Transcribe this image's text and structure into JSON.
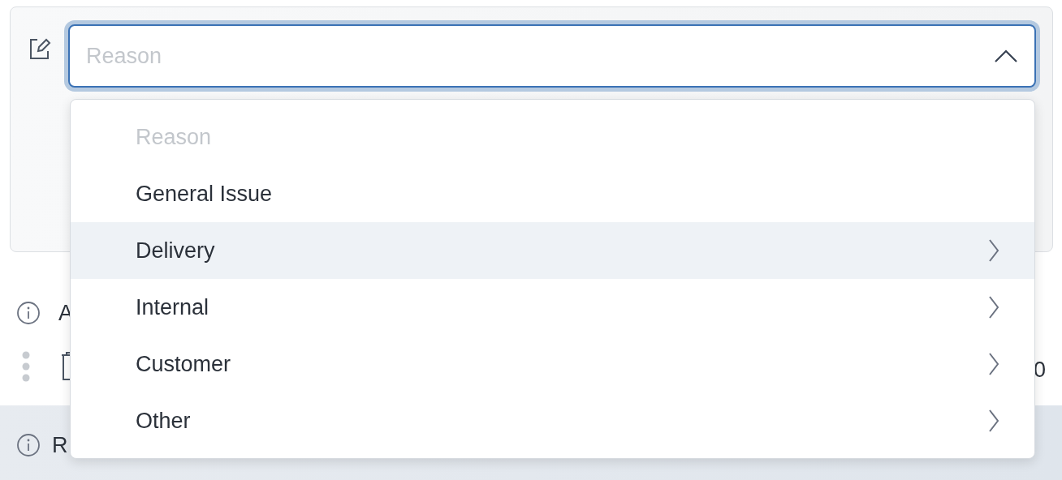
{
  "reason_select": {
    "placeholder": "Reason",
    "expanded": true
  },
  "dropdown": {
    "options": [
      {
        "label": "Reason",
        "disabled": true,
        "highlighted": false,
        "has_submenu": false
      },
      {
        "label": "General Issue",
        "disabled": false,
        "highlighted": false,
        "has_submenu": false
      },
      {
        "label": "Delivery",
        "disabled": false,
        "highlighted": true,
        "has_submenu": true
      },
      {
        "label": "Internal",
        "disabled": false,
        "highlighted": false,
        "has_submenu": true
      },
      {
        "label": "Customer",
        "disabled": false,
        "highlighted": false,
        "has_submenu": true
      },
      {
        "label": "Other",
        "disabled": false,
        "highlighted": false,
        "has_submenu": true
      }
    ]
  },
  "rows": [
    {
      "kind": "info",
      "text": "A"
    },
    {
      "kind": "item",
      "text": "0"
    },
    {
      "kind": "footer",
      "text": "R"
    }
  ]
}
